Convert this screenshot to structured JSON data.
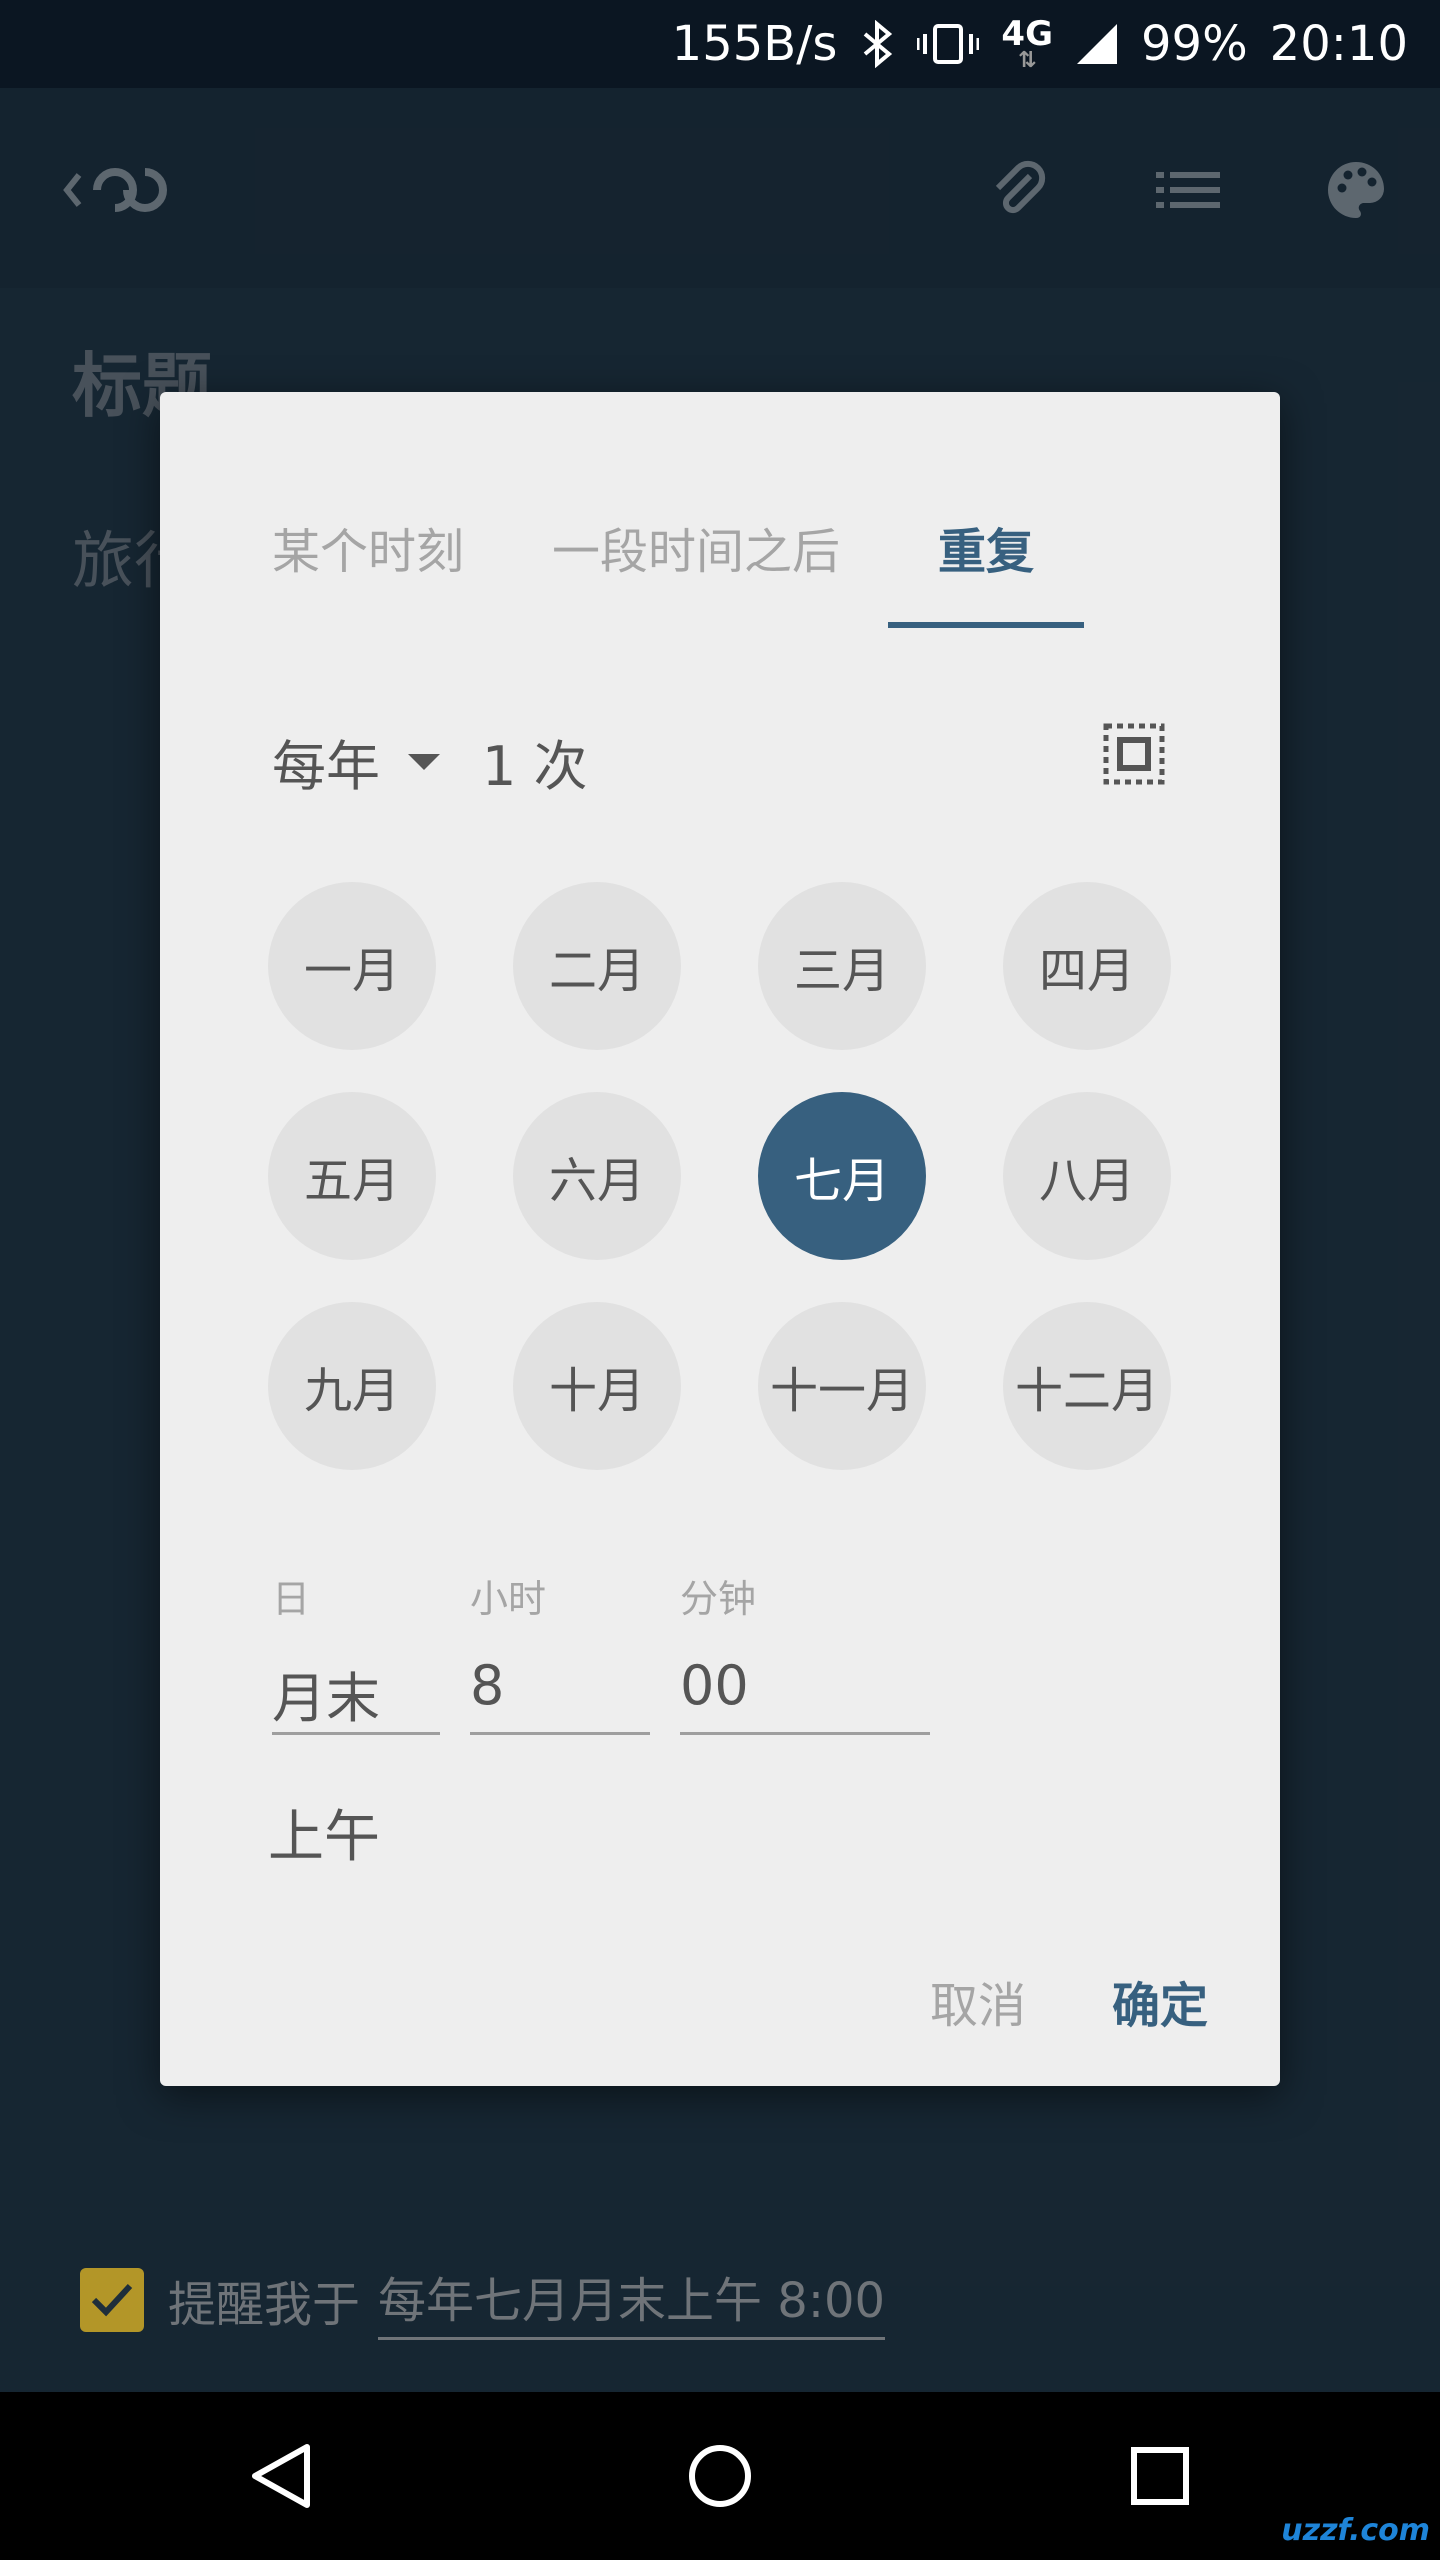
{
  "status_bar": {
    "net_speed": "155B/s",
    "network": "4G",
    "battery": "99%",
    "time": "20:10"
  },
  "app_bar": {
    "icons": [
      "back-icon",
      "attachment-icon",
      "list-icon",
      "palette-icon"
    ]
  },
  "note": {
    "title": "标题",
    "body": "旅行"
  },
  "dialog": {
    "tabs": [
      {
        "label": "某个时刻",
        "active": false
      },
      {
        "label": "一段时间之后",
        "active": false
      },
      {
        "label": "重复",
        "active": true
      }
    ],
    "frequency": "每年",
    "count": "1 次",
    "months": [
      {
        "label": "一月",
        "selected": false
      },
      {
        "label": "二月",
        "selected": false
      },
      {
        "label": "三月",
        "selected": false
      },
      {
        "label": "四月",
        "selected": false
      },
      {
        "label": "五月",
        "selected": false
      },
      {
        "label": "六月",
        "selected": false
      },
      {
        "label": "七月",
        "selected": true
      },
      {
        "label": "八月",
        "selected": false
      },
      {
        "label": "九月",
        "selected": false
      },
      {
        "label": "十月",
        "selected": false
      },
      {
        "label": "十一月",
        "selected": false
      },
      {
        "label": "十二月",
        "selected": false
      }
    ],
    "fields": {
      "day": {
        "label": "日",
        "value": "月末"
      },
      "hour": {
        "label": "小时",
        "value": "8"
      },
      "minute": {
        "label": "分钟",
        "value": "00"
      }
    },
    "ampm": "上午",
    "cancel_label": "取消",
    "ok_label": "确定"
  },
  "reminder": {
    "checked": true,
    "label": "提醒我于",
    "value": "每年七月月末上午 8:00"
  },
  "watermark": "uzzf.com",
  "colors": {
    "accent": "#37607f",
    "dialog_bg": "#eeeeee",
    "month_bg": "#e1e1e1",
    "checkbox": "#b39628"
  }
}
